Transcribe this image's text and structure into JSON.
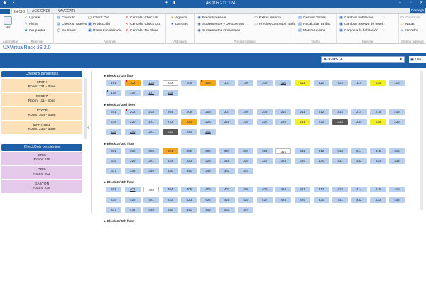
{
  "titlebar": {
    "ip": "46.105.211.124"
  },
  "ribbon_tabs": [
    "INICIO",
    "ACCIONES",
    "NAVEGAR"
  ],
  "ribbon_badge": "Despega",
  "ribbon": {
    "ver_label": "Ver",
    "groups": [
      {
        "label": "Administrar",
        "items": []
      },
      {
        "label": "Reservas",
        "items": [
          "Update",
          "Ficha",
          "Ocupantes"
        ]
      },
      {
        "label": "Acciones",
        "items": [
          "Check In",
          "Check In Masivo",
          "No Show",
          "Check Out",
          "Producción",
          "Pasar Limpia/sucia",
          "Cancelar Check In",
          "Cancelar Check Out",
          "Cancelar No Show"
        ]
      },
      {
        "label": "Astrogaos",
        "items": [
          "Agencia",
          "Directos"
        ]
      },
      {
        "label": "Precios contrato",
        "items": [
          "Precios reserva",
          "Suplementos y Descuentos",
          "Suplementos Opcionales",
          "Extras reserva",
          "Precios Contrato / Tarifa"
        ]
      },
      {
        "label": "Tarifas",
        "items": [
          "Gestion Tarifas",
          "Recalcular Tarifas",
          "Mostrar Avisos"
        ]
      },
      {
        "label": "Navegar",
        "items": [
          "Cambiar habitación",
          "Cambiar reserva de hotel",
          "Cargos a la habitación"
        ]
      },
      {
        "label": "Mostrar adjuntos",
        "items": [
          "Overbook",
          "Notas",
          "Vinculos"
        ]
      }
    ]
  },
  "app": {
    "title": "UXVirtualRack .IS 2.0",
    "hotel": "AUGUSTA",
    "user": "julio"
  },
  "checkins": {
    "title": "Checkins pendientes",
    "items": [
      {
        "name": "SMITH",
        "room": "Room: 231 - Bono"
      },
      {
        "name": "PEREZ",
        "room": "Room: 111 - Bono"
      },
      {
        "name": "JOYCE",
        "room": "Room: 304 - Bono"
      },
      {
        "name": "MARTINEZ",
        "room": "Room: 233 - Bono"
      }
    ]
  },
  "checkouts": {
    "title": "CheckOuts pendientes",
    "items": [
      {
        "name": "GRIS",
        "room": "Room: 119"
      },
      {
        "name": "GRIS",
        "room": "Room: 202"
      },
      {
        "name": "GASTON",
        "room": "Room: 238"
      }
    ]
  },
  "blocks": [
    {
      "label": "Block 1 / 1st floor",
      "rows": [
        [
          {
            "n": "101"
          },
          {
            "n": "102",
            "s": "orange",
            "f": 1
          },
          {
            "n": "103",
            "u": 1
          },
          {
            "n": "104",
            "s": "white"
          },
          {
            "n": "105"
          },
          {
            "n": "106",
            "s": "orange",
            "f": 1
          },
          {
            "n": "107"
          },
          {
            "n": "108"
          },
          {
            "n": "109"
          },
          {
            "n": "110",
            "u": 1
          },
          {
            "n": "111",
            "s": "yellow"
          },
          {
            "n": "112"
          },
          {
            "n": "113"
          },
          {
            "n": "114"
          },
          {
            "n": "115",
            "s": "yellow"
          },
          {
            "n": "116"
          }
        ],
        [
          {
            "n": "119",
            "f": 1
          },
          {
            "n": "120"
          },
          {
            "n": "127",
            "u": 1
          },
          {
            "n": "128",
            "u": 1
          }
        ]
      ]
    },
    {
      "label": "Block 2 / 2nd floor",
      "rows": [
        [
          {
            "n": "201",
            "u": 1
          },
          {
            "n": "202",
            "f": 1
          },
          {
            "n": "203"
          },
          {
            "n": "204",
            "u": 1
          },
          {
            "n": "205"
          },
          {
            "n": "206",
            "u": 1
          },
          {
            "n": "207",
            "u": 1
          },
          {
            "n": "208",
            "u": 1
          },
          {
            "n": "209",
            "u": 1
          },
          {
            "n": "210",
            "u": 1
          },
          {
            "n": "211",
            "u": 1
          },
          {
            "n": "212",
            "u": 1
          },
          {
            "n": "213",
            "u": 1
          },
          {
            "n": "214",
            "u": 1
          },
          {
            "n": "215",
            "u": 1
          },
          {
            "n": "216"
          }
        ],
        [
          {
            "n": "219"
          },
          {
            "n": "220",
            "u": 1
          },
          {
            "n": "221",
            "u": 1
          },
          {
            "n": "222",
            "u": 1
          },
          {
            "n": "223",
            "s": "orange",
            "u": 1
          },
          {
            "n": "224",
            "u": 1
          },
          {
            "n": "225",
            "u": 1
          },
          {
            "n": "226",
            "u": 1
          },
          {
            "n": "227",
            "u": 1
          },
          {
            "n": "228",
            "u": 1
          },
          {
            "n": "231",
            "s": "yellow",
            "u": 1
          },
          {
            "n": "232"
          },
          {
            "n": "233",
            "s": "dark"
          },
          {
            "n": "234",
            "u": 1
          },
          {
            "n": "235",
            "s": "yellow"
          },
          {
            "n": "236"
          }
        ],
        [
          {
            "n": "239",
            "u": 1
          },
          {
            "n": "240",
            "u": 1
          },
          {
            "n": "241"
          },
          {
            "n": "242",
            "s": "dark"
          },
          {
            "n": "243"
          },
          {
            "n": "244",
            "u": 1
          }
        ]
      ]
    },
    {
      "label": "Block 2 / 3rd floor",
      "rows": [
        [
          {
            "n": "301"
          },
          {
            "n": "302"
          },
          {
            "n": "303"
          },
          {
            "n": "304",
            "s": "orange",
            "u": 1
          },
          {
            "n": "305"
          },
          {
            "n": "306"
          },
          {
            "n": "307"
          },
          {
            "n": "308"
          },
          {
            "n": "309",
            "u": 1
          },
          {
            "n": "310",
            "s": "white"
          },
          {
            "n": "311",
            "u": 1
          },
          {
            "n": "312",
            "u": 1
          },
          {
            "n": "313",
            "u": 1
          },
          {
            "n": "314",
            "u": 1
          },
          {
            "n": "315",
            "u": 1
          },
          {
            "n": "316"
          }
        ],
        [
          {
            "n": "319"
          },
          {
            "n": "320"
          },
          {
            "n": "321"
          },
          {
            "n": "322"
          },
          {
            "n": "323"
          },
          {
            "n": "324"
          },
          {
            "n": "325"
          },
          {
            "n": "326"
          },
          {
            "n": "327"
          },
          {
            "n": "328"
          },
          {
            "n": "329"
          },
          {
            "n": "330"
          },
          {
            "n": "331"
          },
          {
            "n": "332"
          },
          {
            "n": "333"
          },
          {
            "n": "334"
          }
        ],
        [
          {
            "n": "337"
          },
          {
            "n": "338"
          },
          {
            "n": "339"
          },
          {
            "n": "340"
          },
          {
            "n": "341"
          },
          {
            "n": "342"
          },
          {
            "n": "343"
          },
          {
            "n": "344"
          }
        ]
      ]
    },
    {
      "label": "Block 2 / 4th floor",
      "rows": [
        [
          {
            "n": "401"
          },
          {
            "n": "402",
            "u": 1
          },
          {
            "n": "403",
            "s": "white"
          },
          {
            "n": "404"
          },
          {
            "n": "405"
          },
          {
            "n": "406"
          },
          {
            "n": "407"
          },
          {
            "n": "408"
          },
          {
            "n": "409"
          },
          {
            "n": "410"
          },
          {
            "n": "411"
          },
          {
            "n": "412"
          },
          {
            "n": "413"
          },
          {
            "n": "414"
          },
          {
            "n": "415"
          },
          {
            "n": "416"
          }
        ],
        [
          {
            "n": "419"
          },
          {
            "n": "420"
          },
          {
            "n": "421"
          },
          {
            "n": "422"
          },
          {
            "n": "423"
          },
          {
            "n": "424"
          },
          {
            "n": "425"
          },
          {
            "n": "426"
          },
          {
            "n": "427"
          },
          {
            "n": "428"
          },
          {
            "n": "429"
          },
          {
            "n": "430"
          },
          {
            "n": "431"
          },
          {
            "n": "432"
          },
          {
            "n": "433"
          },
          {
            "n": "434"
          }
        ],
        [
          {
            "n": "437"
          },
          {
            "n": "438"
          },
          {
            "n": "439"
          },
          {
            "n": "440"
          },
          {
            "n": "441"
          },
          {
            "n": "442",
            "u": 1
          },
          {
            "n": "443"
          },
          {
            "n": "444"
          }
        ]
      ]
    },
    {
      "label": "Block 3 / 5th floor",
      "rows": []
    }
  ]
}
